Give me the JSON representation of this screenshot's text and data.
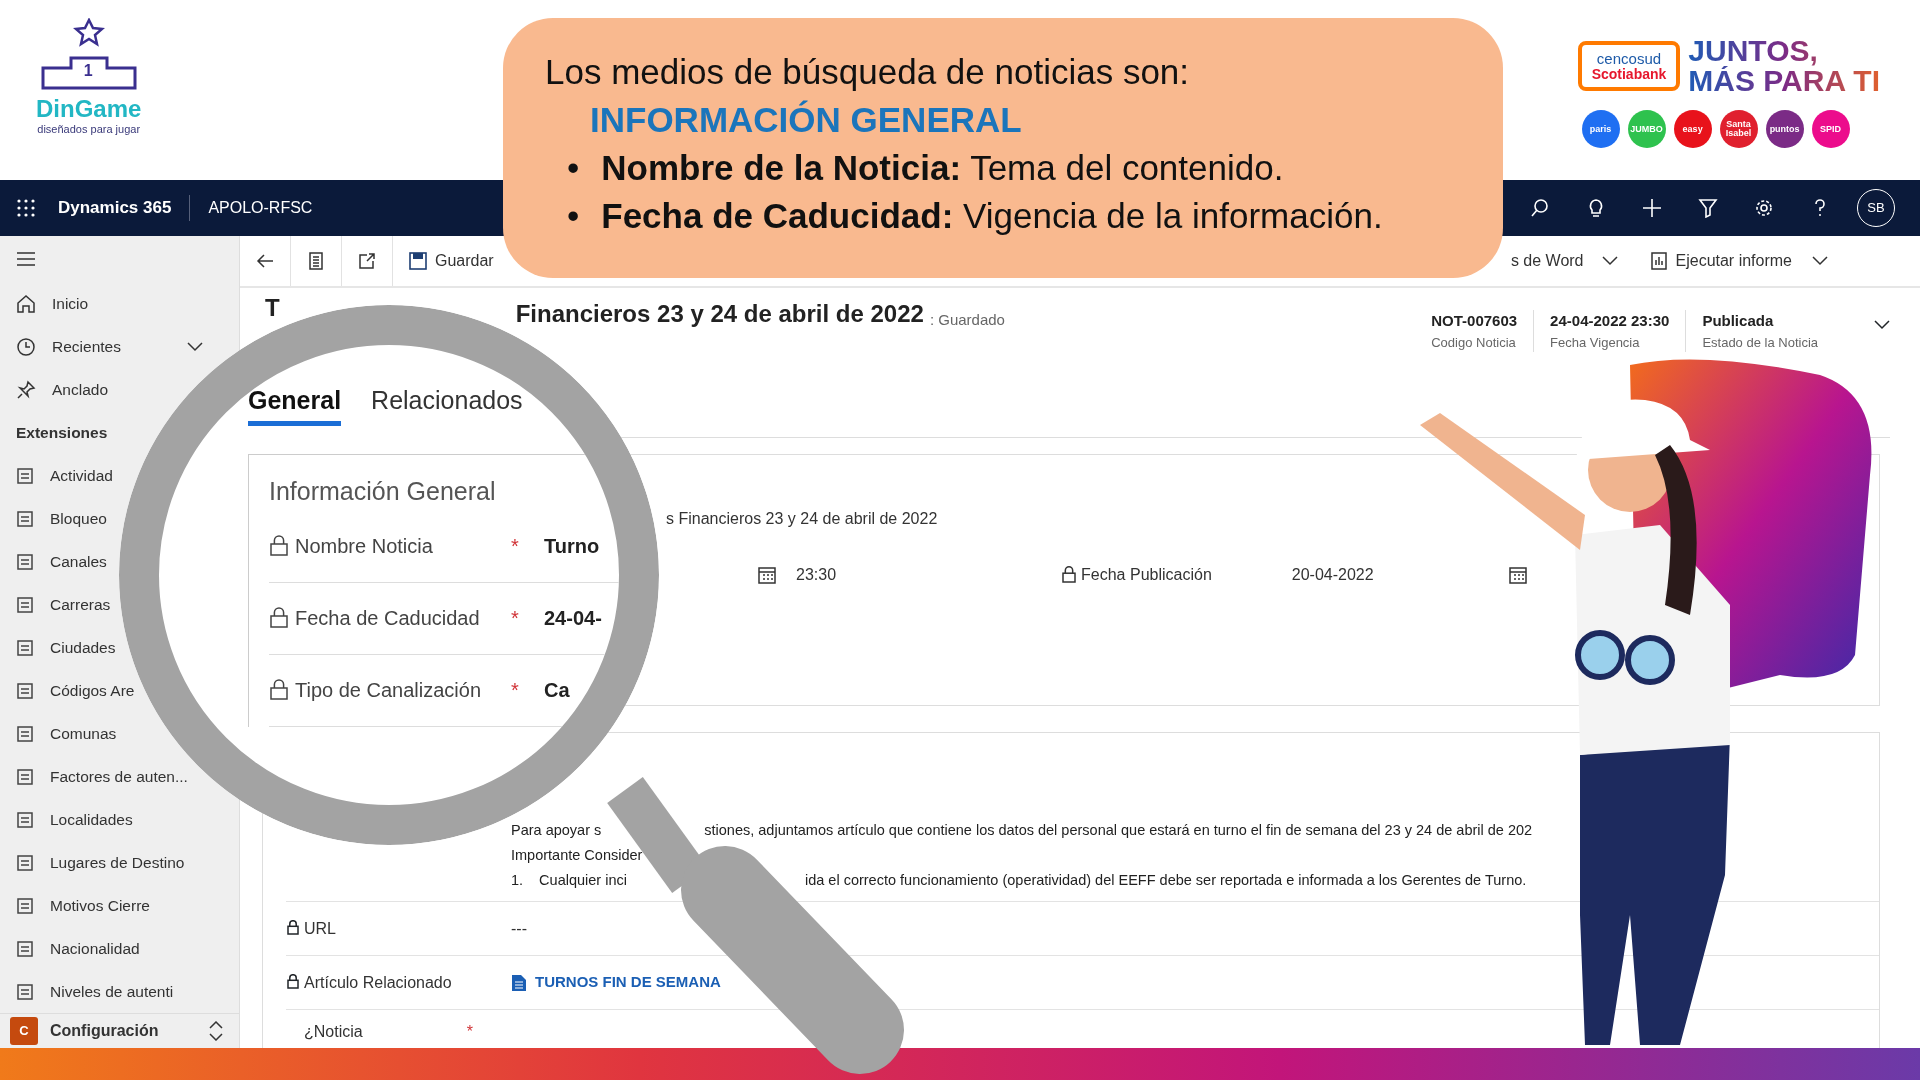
{
  "logo": {
    "podium_number": "1",
    "name": "DinGame",
    "tagline": "diseñados para jugar"
  },
  "callout": {
    "intro": "Los medios de búsqueda de noticias son:",
    "heading": "INFORMACIÓN GENERAL",
    "bullets": [
      {
        "marker": "•",
        "text": "**Nombre de la Noticia:** Tema del contenido."
      },
      {
        "marker": "•",
        "text": "**Fecha de Caducidad:** Vigencia de la información."
      }
    ]
  },
  "sponsor": {
    "box_lines": [
      "cencosud",
      "Scotiabank"
    ],
    "slogan_lines": [
      "JUNTOS,",
      "MÁS PARA TI"
    ],
    "brands": [
      {
        "label": "paris",
        "color": "#1f6ff2"
      },
      {
        "label": "JUMBO",
        "color": "#2ec24e"
      },
      {
        "label": "easy",
        "color": "#e8121b"
      },
      {
        "label": "Santa Isabel",
        "color": "#e0202e"
      },
      {
        "label": "puntos",
        "color": "#7b2b86"
      },
      {
        "label": "SPID",
        "color": "#ec0c8c"
      }
    ]
  },
  "navbar": {
    "app": "Dynamics 365",
    "environment": "APOLO-RFSC",
    "avatar": "SB"
  },
  "sidebar": {
    "nav": [
      {
        "label": "Inicio",
        "kind": "home"
      },
      {
        "label": "Recientes",
        "kind": "recent"
      },
      {
        "label": "Anclado",
        "kind": "pinned"
      }
    ],
    "section": "Extensiones",
    "entities": [
      "Actividad",
      "Bloqueo",
      "Canales",
      "Carreras",
      "Ciudades",
      "Códigos Are",
      "Comunas",
      "Factores de auten...",
      "Localidades",
      "Lugares de Destino",
      "Motivos Cierre",
      "Nacionalidad",
      "Niveles de autenti"
    ],
    "area": {
      "letter": "C",
      "label": "Configuración"
    }
  },
  "toolbar": {
    "save": "Guardar",
    "word": "s de Word",
    "report": "Ejecutar informe"
  },
  "record": {
    "title_start": "T",
    "title_end": "Financieros 23 y 24 de abril de 2022",
    "save_state": ": Guardado",
    "fields": [
      {
        "value": "NOT-007603",
        "label": "Codigo Noticia"
      },
      {
        "value": "24-04-2022 23:30",
        "label": "Fecha Vigencia"
      },
      {
        "value": "Publicada",
        "label": "Estado de la Noticia"
      }
    ]
  },
  "magnifier": {
    "tabs": [
      {
        "label": "General",
        "selected": true
      },
      {
        "label": "Relacionados",
        "selected": false
      }
    ],
    "section": "Información General",
    "fields": [
      {
        "label": "Nombre Noticia",
        "required": true,
        "required_mark": "*",
        "value": "Turno"
      },
      {
        "label": "Fecha de Caducidad",
        "required": true,
        "required_mark": "*",
        "value": "24-04-"
      },
      {
        "label": "Tipo de Canalización",
        "required": true,
        "required_mark": "*",
        "value": "Ca"
      }
    ]
  },
  "form": {
    "name_value": "s Financieros 23 y 24 de abril de 2022",
    "time": "23:30",
    "pub_label": "Fecha Publicación",
    "pub_value": "20-04-2022",
    "paragraph": [
      [
        "Para apoyar s",
        "stiones, adjuntamos artículo que contiene los datos del personal que estará en turno el fin de semana del 23 y 24 de abril de 202"
      ],
      [
        "Importante Consider"
      ],
      [
        "1.",
        "Cualquier inci",
        "ida el correcto funcionamiento (operatividad) del EEFF debe ser reportada e informada a los Gerentes de Turno."
      ]
    ],
    "url_label": "URL",
    "url_value": "---",
    "article_label": "Artículo Relacionado",
    "article_link": "TURNOS FIN DE SEMANA",
    "question_label": "¿Noticia",
    "question_required": true,
    "question_required_mark": "*"
  }
}
